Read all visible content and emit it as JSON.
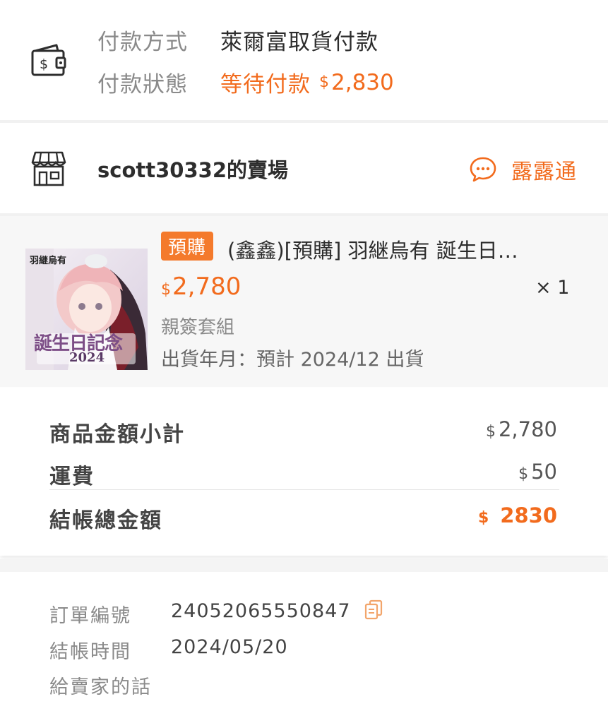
{
  "payment": {
    "method_label": "付款方式",
    "method_value": "萊爾富取貨付款",
    "status_label": "付款狀態",
    "status_value": "等待付款",
    "amount_currency": "$",
    "amount": "2,830",
    "icon": "wallet-icon"
  },
  "seller": {
    "name": "scott30332的賣場",
    "chat_label": "露露通",
    "icon": "shop-icon",
    "chat_icon": "chat-bubble-icon"
  },
  "product": {
    "badge": "預購",
    "title": "(鑫鑫)[預購] 羽継烏有 誕生日…",
    "price_currency": "$",
    "price": "2,780",
    "quantity": "× 1",
    "variant": "親簽套組",
    "shipping": "出貨年月：預計 2024/12 出貨",
    "image": {
      "top_text": "羽継烏有",
      "caption": "誕生日記念",
      "year": "2024"
    }
  },
  "totals": {
    "subtotal_label": "商品金額小計",
    "subtotal_currency": "$",
    "subtotal_value": "2,780",
    "shipping_label": "運費",
    "shipping_currency": "$",
    "shipping_value": "50",
    "grand_label": "結帳總金額",
    "grand_currency": "$",
    "grand_value": "2830"
  },
  "order": {
    "number_label": "訂單編號",
    "number_value": "24052065550847",
    "time_label": "結帳時間",
    "time_value": "2024/05/20",
    "note_label": "給賣家的話",
    "copy_icon": "copy-icon"
  },
  "colors": {
    "accent": "#f26b1d",
    "badge": "#f47a2c",
    "muted": "#8a8a8a"
  }
}
